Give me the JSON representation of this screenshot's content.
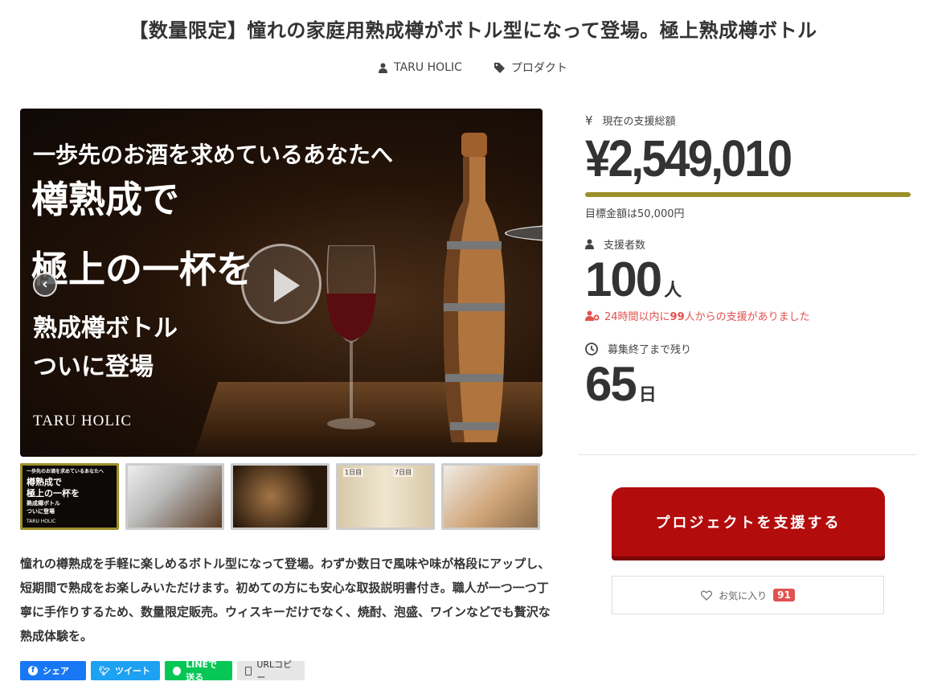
{
  "header": {
    "title": "【数量限定】憧れの家庭用熟成樽がボトル型になって登場。極上熟成樽ボトル",
    "author": "TARU HOLIC",
    "category": "プロダクト"
  },
  "hero": {
    "line1": "一歩先のお酒を求めているあなたへ",
    "line2": "樽熟成で",
    "line3": "極上の一杯を",
    "line4": "熟成樽ボトル",
    "line5": "ついに登場",
    "brand": "TARU HOLIC"
  },
  "thumbnails": {
    "t1_line1": "一歩先のお酒を求めているあなたへ",
    "t1_line2": "樽熟成で",
    "t1_line3": "極上の一杯を",
    "t1_line4": "熟成樽ボトル",
    "t1_line5": "ついに登場",
    "t1_brand": "TARU HOLIC",
    "t4_left": "1日目",
    "t4_right": "7日目"
  },
  "description": "憧れの樽熟成を手軽に楽しめるボトル型になって登場。わずか数日で風味や味が格段にアップし、短期間で熟成をお楽しみいただけます。初めての方にも安心な取扱説明書付き。職人が一つ一つ丁寧に手作りするため、数量限定販売。ウィスキーだけでなく、焼酎、泡盛、ワインなどでも贅沢な熟成体験を。",
  "share": {
    "facebook": "シェア",
    "twitter": "ツイート",
    "line": "LINEで送る",
    "url": "URLコピー"
  },
  "stats": {
    "total_label": "現在の支援総額",
    "yen_symbol": "¥",
    "total": "¥2,549,010",
    "progress_fraction": 1.0,
    "goal_text": "目標金額は50,000円",
    "supporters_label": "支援者数",
    "supporters": "100",
    "supporters_unit": "人",
    "recent_prefix": "24時間以内に",
    "recent_count": "99",
    "recent_suffix": "人からの支援がありました",
    "remaining_label": "募集終了まで残り",
    "remaining": "65",
    "remaining_unit": "日"
  },
  "actions": {
    "support_button": "プロジェクトを支援する",
    "favorite_label": "お気に入り",
    "favorite_count": "91"
  },
  "colors": {
    "accent": "#9c8f2a",
    "support": "#b30c0c",
    "alert": "#e0524f"
  }
}
